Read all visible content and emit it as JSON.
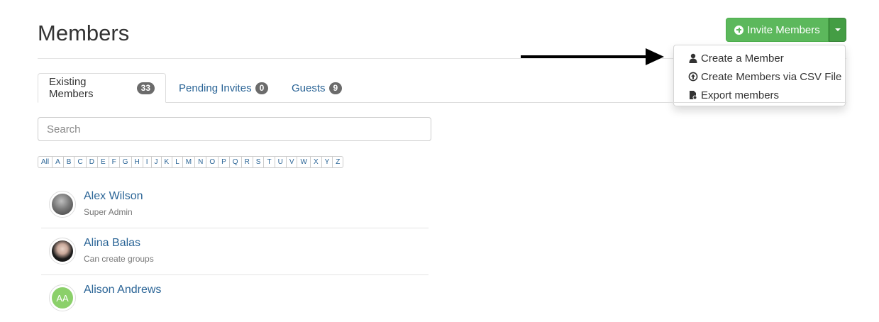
{
  "header": {
    "title": "Members",
    "invite_label": "Invite Members"
  },
  "dropdown": {
    "items": [
      {
        "label": "Create a Member",
        "icon": "user-icon"
      },
      {
        "label": "Create Members via CSV File",
        "icon": "upload-circle-icon"
      },
      {
        "label": "Export members",
        "icon": "export-file-icon"
      }
    ]
  },
  "tabs": [
    {
      "label": "Existing Members",
      "count": "33",
      "active": true
    },
    {
      "label": "Pending Invites",
      "count": "0",
      "active": false
    },
    {
      "label": "Guests",
      "count": "9",
      "active": false
    }
  ],
  "search": {
    "placeholder": "Search"
  },
  "alphabet": [
    "All",
    "A",
    "B",
    "C",
    "D",
    "E",
    "F",
    "G",
    "H",
    "I",
    "J",
    "K",
    "L",
    "M",
    "N",
    "O",
    "P",
    "Q",
    "R",
    "S",
    "T",
    "U",
    "V",
    "W",
    "X",
    "Y",
    "Z"
  ],
  "members": [
    {
      "name": "Alex Wilson",
      "role": "Super Admin",
      "avatar": "photo"
    },
    {
      "name": "Alina Balas",
      "role": "Can create groups",
      "avatar": "photo"
    },
    {
      "name": "Alison Andrews",
      "role": "",
      "avatar": "AA"
    }
  ],
  "colors": {
    "primary_button": "#5cb85c",
    "link": "#2a6496",
    "badge": "#6b6b6b",
    "initials_avatar": "#8bd06a"
  }
}
